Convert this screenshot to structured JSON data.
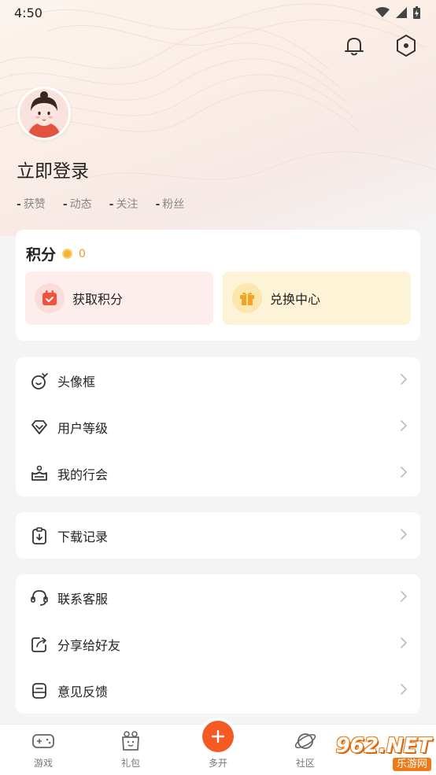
{
  "status_bar": {
    "time": "4:50"
  },
  "profile": {
    "login_label": "立即登录",
    "stats": [
      {
        "value": "-",
        "label": "获赞"
      },
      {
        "value": "-",
        "label": "动态"
      },
      {
        "value": "-",
        "label": "关注"
      },
      {
        "value": "-",
        "label": "粉丝"
      }
    ]
  },
  "points": {
    "title": "积分",
    "value": "0",
    "earn_label": "获取积分",
    "exchange_label": "兑换中心"
  },
  "menu": {
    "group1": [
      {
        "label": "头像框",
        "icon": "avatar-frame-icon"
      },
      {
        "label": "用户等级",
        "icon": "diamond-icon"
      },
      {
        "label": "我的行会",
        "icon": "guild-icon"
      }
    ],
    "group2": [
      {
        "label": "下载记录",
        "icon": "download-icon"
      }
    ],
    "group3": [
      {
        "label": "联系客服",
        "icon": "headset-icon"
      },
      {
        "label": "分享给好友",
        "icon": "share-icon"
      },
      {
        "label": "意见反馈",
        "icon": "feedback-icon"
      }
    ]
  },
  "tabbar": {
    "tabs": [
      {
        "label": "游戏",
        "icon": "gamepad-icon"
      },
      {
        "label": "礼包",
        "icon": "gift-bag-icon"
      },
      {
        "label": "多开",
        "icon": "plus-icon"
      },
      {
        "label": "社区",
        "icon": "planet-icon"
      }
    ]
  },
  "watermark": {
    "big": "962.NET",
    "small": "乐游网"
  },
  "colors": {
    "accent": "#f55a24",
    "coin": "#f5b533",
    "earn_bg": "#fdeeed",
    "exchange_bg": "#fdf3d7"
  }
}
